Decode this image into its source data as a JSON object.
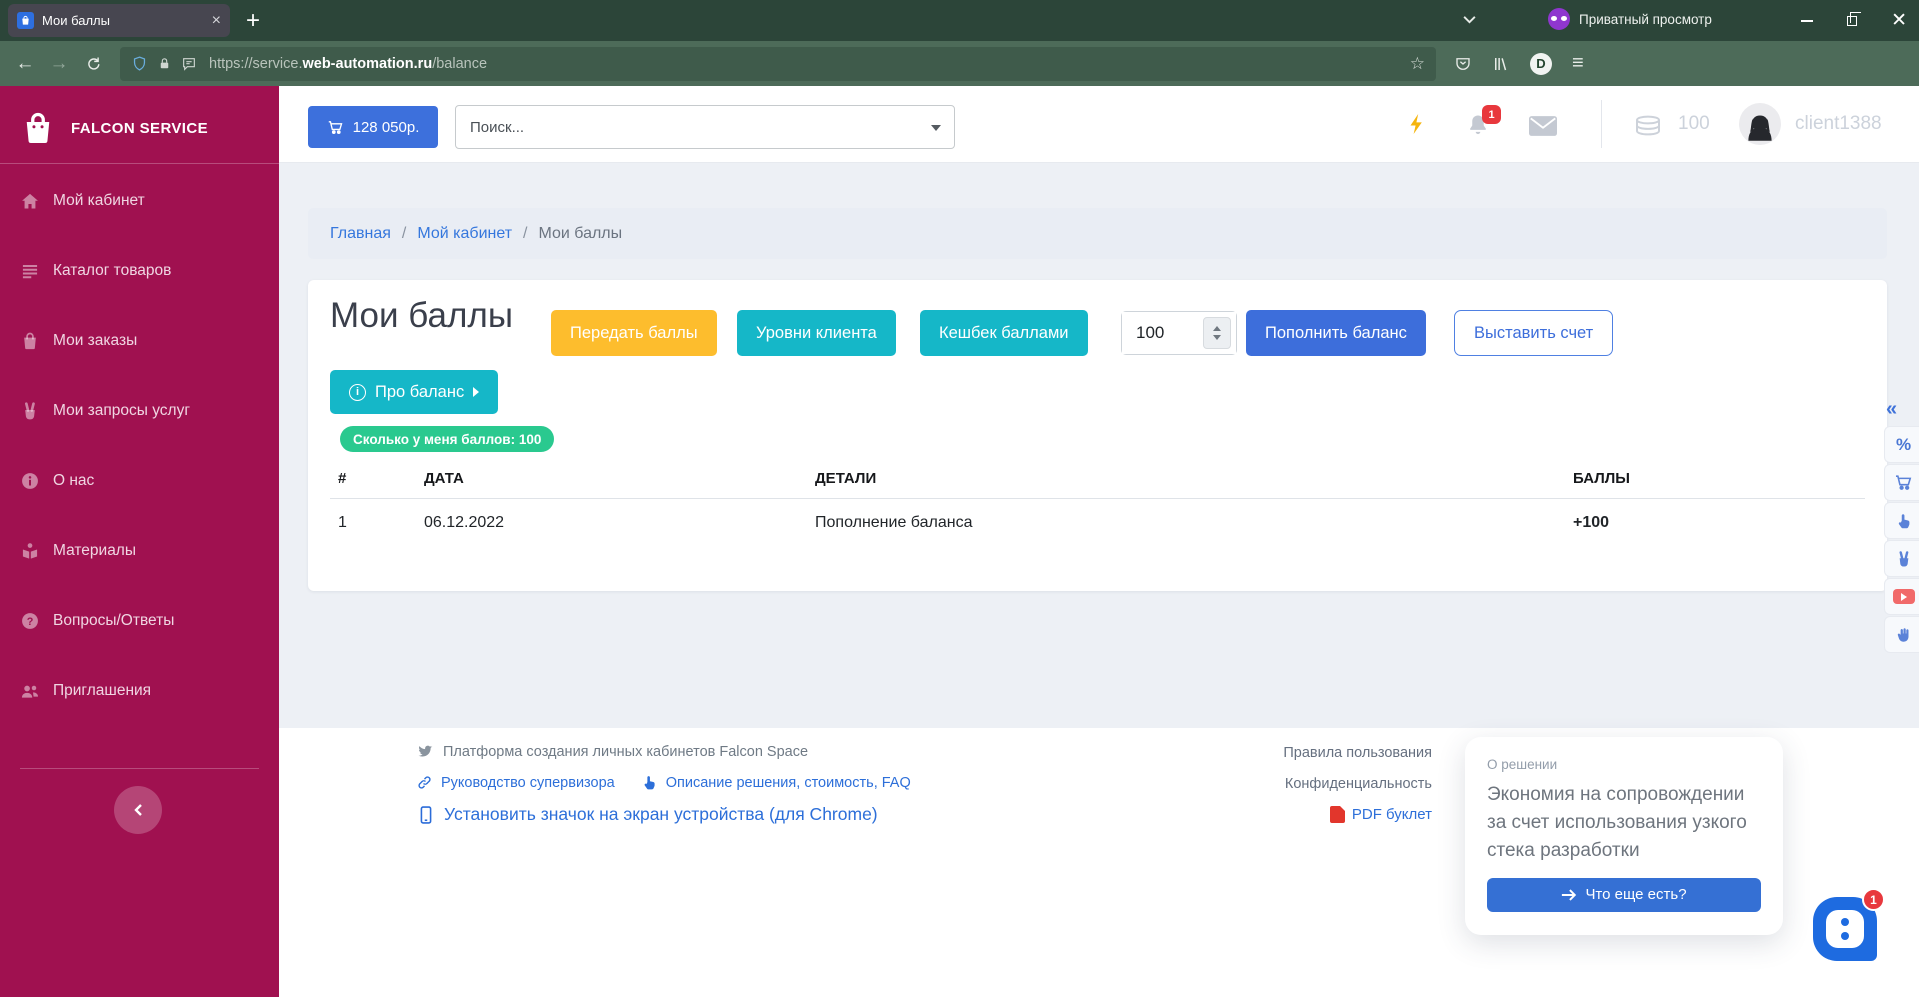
{
  "browser": {
    "tab_title": "Мои баллы",
    "new_tab": "+",
    "private_label": "Приватный просмотр",
    "url": {
      "prefix": "https://service.",
      "domain": "web-automation.ru",
      "path": "/balance"
    },
    "account_initial": "D"
  },
  "sidebar": {
    "brand": "FALCON SERVICE",
    "items": [
      {
        "label": "Мой кабинет",
        "icon": "home-icon"
      },
      {
        "label": "Каталог товаров",
        "icon": "list-icon"
      },
      {
        "label": "Мои заказы",
        "icon": "shopping-bag-icon"
      },
      {
        "label": "Мои запросы услуг",
        "icon": "victory-hand-icon"
      },
      {
        "label": "О нас",
        "icon": "info-icon"
      },
      {
        "label": "Материалы",
        "icon": "book-reader-icon"
      },
      {
        "label": "Вопросы/Ответы",
        "icon": "question-icon"
      },
      {
        "label": "Приглашения",
        "icon": "users-icon"
      }
    ]
  },
  "header": {
    "cart_total": "128 050р.",
    "search_placeholder": "Поиск...",
    "notification_badge": "1",
    "points": "100",
    "username": "client1388",
    "icons": [
      "lightning-icon",
      "bell-icon",
      "envelope-icon",
      "coins-icon",
      "avatar"
    ]
  },
  "breadcrumb": {
    "home": "Главная",
    "cabinet": "Мой кабинет",
    "current": "Мои баллы",
    "separator": "/"
  },
  "main": {
    "title": "Мои баллы",
    "transfer_button": "Передать баллы",
    "levels_button": "Уровни клиента",
    "cashback_button": "Кешбек баллами",
    "amount_value": "100",
    "topup_button": "Пополнить баланс",
    "invoice_button": "Выставить счет",
    "about_balance_button": "Про баланс",
    "balance_badge": "Сколько у меня баллов: 100",
    "table": {
      "headers": [
        "#",
        "ДАТА",
        "ДЕТАЛИ",
        "БАЛЛЫ"
      ],
      "rows": [
        {
          "num": "1",
          "date": "06.12.2022",
          "details": "Пополнение баланса",
          "points": "+100"
        }
      ]
    }
  },
  "footer": {
    "platform_text": "Платформа создания личных кабинетов Falcon Space",
    "supervisor_link": "Руководство супервизора",
    "solution_link": "Описание решения, стоимость, FAQ",
    "install_link": "Установить значок на экран устройства (для Chrome)",
    "terms_link": "Правила пользования",
    "privacy_link": "Конфиденциальность",
    "pdf_link": "PDF буклет"
  },
  "promo": {
    "title": "О решении",
    "text": "Экономия на сопровождении за счет использования узкого стека разработки",
    "button": "Что еще есть?"
  },
  "chat": {
    "badge": "1"
  },
  "rail": {
    "icons": [
      "collapse-left-icon",
      "percent-icon",
      "cart-icon",
      "point-finger-icon",
      "victory-hand-icon",
      "youtube-icon",
      "raised-hand-icon"
    ]
  },
  "colors": {
    "sidebar": "#a01150",
    "accent_blue": "#3d6edb",
    "teal": "#15b7c8",
    "yellow": "#fdbd2d",
    "badge_green": "#2ac98f",
    "points_green": "#0cc28e",
    "notification_red": "#e8383d"
  }
}
